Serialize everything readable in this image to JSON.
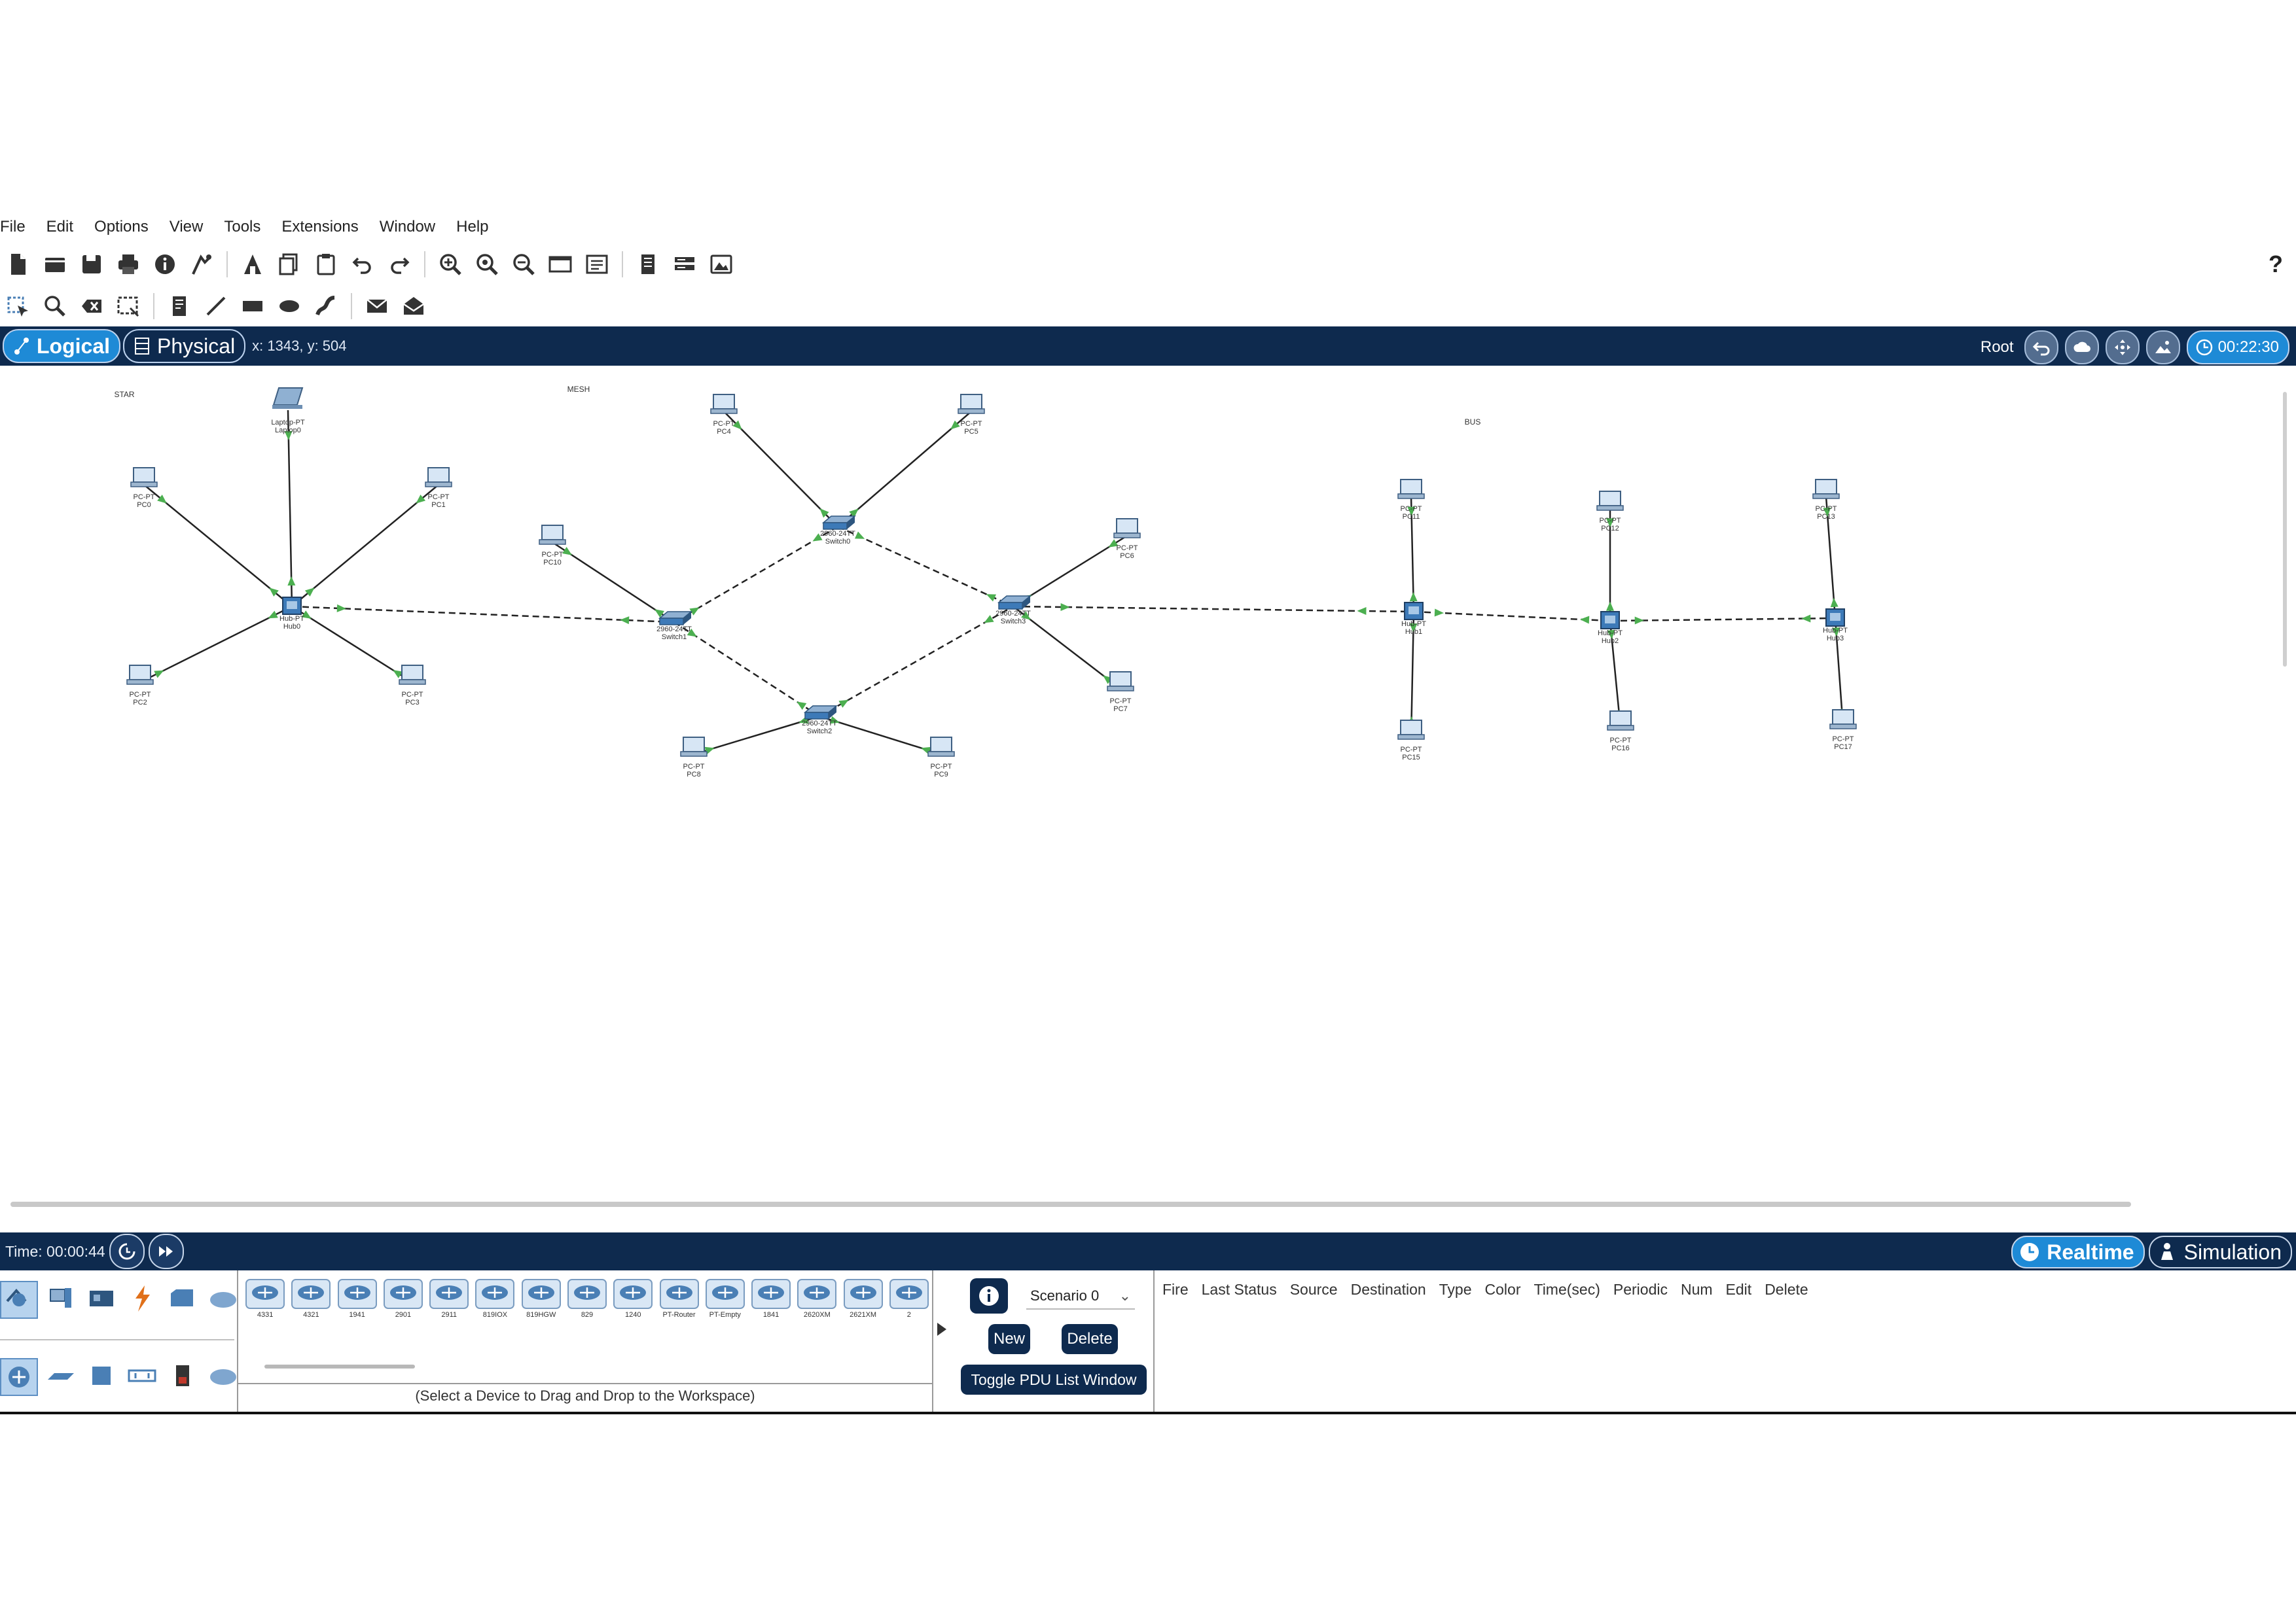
{
  "menu": [
    "File",
    "Edit",
    "Options",
    "View",
    "Tools",
    "Extensions",
    "Window",
    "Help"
  ],
  "toolbar": {
    "help_label": "?",
    "main_icons": [
      "new-file-icon",
      "open-folder-icon",
      "save-icon",
      "print-icon",
      "info-icon",
      "activity-wizard-icon",
      "custom-pdu-icon",
      "copy-icon",
      "paste-icon",
      "undo-icon",
      "redo-icon",
      "zoom-in-icon",
      "zoom-reset-icon",
      "zoom-out-icon",
      "drawing-palette-icon",
      "custom-device-icon",
      "network-info-icon",
      "cluster-icon",
      "viewport-icon"
    ],
    "tool_icons": [
      "select-icon",
      "inspect-icon",
      "delete-icon",
      "resize-icon",
      "note-icon",
      "line-icon",
      "rectangle-icon",
      "ellipse-icon",
      "freeform-icon",
      "simple-pdu-icon",
      "complex-pdu-icon"
    ]
  },
  "modebar": {
    "logical_label": "Logical",
    "physical_label": "Physical",
    "coords": "x: 1343, y: 504",
    "root_label": "Root",
    "clock": "00:22:30"
  },
  "topology": {
    "area_labels": [
      {
        "id": "star",
        "text": "STAR"
      },
      {
        "id": "mesh",
        "text": "MESH"
      },
      {
        "id": "bus",
        "text": "BUS"
      }
    ],
    "devices": [
      {
        "id": "laptop0",
        "kind": "laptop",
        "model": "Laptop-PT",
        "name": "Laptop0"
      },
      {
        "id": "pc0",
        "kind": "pc",
        "model": "PC-PT",
        "name": "PC0"
      },
      {
        "id": "pc1",
        "kind": "pc",
        "model": "PC-PT",
        "name": "PC1"
      },
      {
        "id": "pc2",
        "kind": "pc",
        "model": "PC-PT",
        "name": "PC2"
      },
      {
        "id": "pc3",
        "kind": "pc",
        "model": "PC-PT",
        "name": "PC3"
      },
      {
        "id": "hub0",
        "kind": "hub",
        "model": "Hub-PT",
        "name": "Hub0"
      },
      {
        "id": "pc4",
        "kind": "pc",
        "model": "PC-PT",
        "name": "PC4"
      },
      {
        "id": "pc5",
        "kind": "pc",
        "model": "PC-PT",
        "name": "PC5"
      },
      {
        "id": "sw0",
        "kind": "switch",
        "model": "2960-24TT",
        "name": "Switch0"
      },
      {
        "id": "pc10",
        "kind": "pc",
        "model": "PC-PT",
        "name": "PC10"
      },
      {
        "id": "sw1",
        "kind": "switch",
        "model": "2960-24TT",
        "name": "Switch1"
      },
      {
        "id": "sw2",
        "kind": "switch",
        "model": "2960-24TT",
        "name": "Switch2"
      },
      {
        "id": "sw3",
        "kind": "switch",
        "model": "2960-24TT",
        "name": "Switch3"
      },
      {
        "id": "pc6",
        "kind": "pc",
        "model": "PC-PT",
        "name": "PC6"
      },
      {
        "id": "pc7",
        "kind": "pc",
        "model": "PC-PT",
        "name": "PC7"
      },
      {
        "id": "pc8",
        "kind": "pc",
        "model": "PC-PT",
        "name": "PC8"
      },
      {
        "id": "pc9",
        "kind": "pc",
        "model": "PC-PT",
        "name": "PC9"
      },
      {
        "id": "pc11",
        "kind": "pc",
        "model": "PC-PT",
        "name": "PC11"
      },
      {
        "id": "pc12",
        "kind": "pc",
        "model": "PC-PT",
        "name": "PC12"
      },
      {
        "id": "pc13",
        "kind": "pc",
        "model": "PC-PT",
        "name": "PC13"
      },
      {
        "id": "hub1",
        "kind": "hub",
        "model": "Hub-PT",
        "name": "Hub1"
      },
      {
        "id": "hub2",
        "kind": "hub",
        "model": "Hub-PT",
        "name": "Hub2"
      },
      {
        "id": "hub3",
        "kind": "hub",
        "model": "Hub-PT",
        "name": "Hub3"
      },
      {
        "id": "pc15",
        "kind": "pc",
        "model": "PC-PT",
        "name": "PC15"
      },
      {
        "id": "pc16",
        "kind": "pc",
        "model": "PC-PT",
        "name": "PC16"
      },
      {
        "id": "pc17",
        "kind": "pc",
        "model": "PC-PT",
        "name": "PC17"
      }
    ],
    "links": [
      {
        "from": "hub0",
        "to": "laptop0",
        "type": "straight"
      },
      {
        "from": "hub0",
        "to": "pc0",
        "type": "straight"
      },
      {
        "from": "hub0",
        "to": "pc1",
        "type": "straight"
      },
      {
        "from": "hub0",
        "to": "pc2",
        "type": "straight"
      },
      {
        "from": "hub0",
        "to": "pc3",
        "type": "straight"
      },
      {
        "from": "hub0",
        "to": "sw1",
        "type": "cross"
      },
      {
        "from": "sw0",
        "to": "pc4",
        "type": "straight"
      },
      {
        "from": "sw0",
        "to": "pc5",
        "type": "straight"
      },
      {
        "from": "sw0",
        "to": "sw1",
        "type": "cross"
      },
      {
        "from": "sw0",
        "to": "sw3",
        "type": "cross"
      },
      {
        "from": "sw1",
        "to": "pc10",
        "type": "straight"
      },
      {
        "from": "sw1",
        "to": "sw2",
        "type": "cross"
      },
      {
        "from": "sw2",
        "to": "pc8",
        "type": "straight"
      },
      {
        "from": "sw2",
        "to": "pc9",
        "type": "straight"
      },
      {
        "from": "sw2",
        "to": "sw3",
        "type": "cross"
      },
      {
        "from": "sw3",
        "to": "pc6",
        "type": "straight"
      },
      {
        "from": "sw3",
        "to": "pc7",
        "type": "straight"
      },
      {
        "from": "sw3",
        "to": "hub1",
        "type": "cross"
      },
      {
        "from": "hub1",
        "to": "pc11",
        "type": "straight"
      },
      {
        "from": "hub1",
        "to": "pc15",
        "type": "straight"
      },
      {
        "from": "hub1",
        "to": "hub2",
        "type": "cross"
      },
      {
        "from": "hub2",
        "to": "pc12",
        "type": "straight"
      },
      {
        "from": "hub2",
        "to": "pc16",
        "type": "straight"
      },
      {
        "from": "hub2",
        "to": "hub3",
        "type": "cross"
      },
      {
        "from": "hub3",
        "to": "pc13",
        "type": "straight"
      },
      {
        "from": "hub3",
        "to": "pc17",
        "type": "straight"
      }
    ]
  },
  "statusbar": {
    "time_label": "Time: 00:00:44",
    "realtime_label": "Realtime",
    "simulation_label": "Simulation"
  },
  "device_panel": {
    "category_icons": [
      "network-devices-icon",
      "end-devices-icon",
      "components-icon",
      "connections-icon",
      "miscellaneous-icon",
      "multiuser-icon"
    ],
    "subcategory_icons": [
      "routers-icon",
      "switches-icon",
      "hubs-icon",
      "wireless-devices-icon",
      "security-icon",
      "wan-emulation-icon"
    ],
    "models": [
      "4331",
      "4321",
      "1941",
      "2901",
      "2911",
      "819IOX",
      "819HGW",
      "829",
      "1240",
      "PT-Router",
      "PT-Empty",
      "1841",
      "2620XM",
      "2621XM",
      "2"
    ],
    "hint": "(Select a Device to Drag and Drop to the Workspace)"
  },
  "scenario": {
    "selected": "Scenario 0",
    "new_label": "New",
    "delete_label": "Delete",
    "toggle_label": "Toggle PDU List Window"
  },
  "pdu_columns": [
    "Fire",
    "Last Status",
    "Source",
    "Destination",
    "Type",
    "Color",
    "Time(sec)",
    "Periodic",
    "Num",
    "Edit",
    "Delete"
  ],
  "colors": {
    "chrome_navy": "#0e2a4e",
    "active_blue": "#1e8ad6",
    "link_green": "#4caf50",
    "device_blue": "#3d7ab8"
  }
}
